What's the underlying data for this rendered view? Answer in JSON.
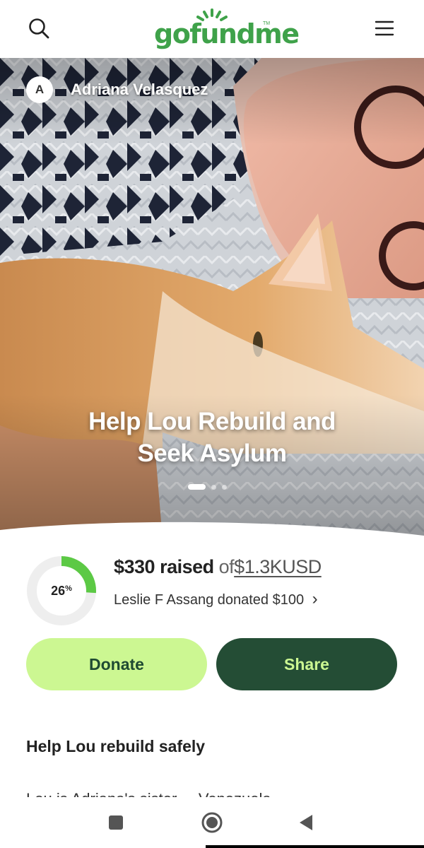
{
  "header": {
    "logo_text": "gofundme",
    "logo_tm": "TM",
    "search_icon": "search-icon",
    "menu_icon": "menu-icon",
    "brand_color": "#3fa24a"
  },
  "hero": {
    "organizer_initial": "A",
    "organizer_name": "Adriana Velasquez",
    "title_line1": "Help Lou Rebuild and",
    "title_line2": "Seek Asylum",
    "carousel_active_index": 0,
    "carousel_count": 3
  },
  "progress": {
    "percent_value": "26",
    "percent_sign": "%",
    "fraction": 0.26,
    "raised_amount": "$330 raised",
    "of_text": "of",
    "goal": "$1.3KUSD",
    "recent_donation": "Leslie F Assang donated $100",
    "recent_arrow": "›",
    "ring_color": "#5cc945",
    "track_color": "#eeeeee"
  },
  "actions": {
    "donate_label": "Donate",
    "share_label": "Share",
    "donate_bg": "#ccf792",
    "share_bg": "#244d35"
  },
  "story": {
    "heading": "Help Lou rebuild safely",
    "first_line": "Lou is Adriana's sister ... Venezuela"
  },
  "system_nav": {
    "recents_icon": "square-icon",
    "home_icon": "home-circle-icon",
    "back_icon": "back-triangle-icon"
  }
}
